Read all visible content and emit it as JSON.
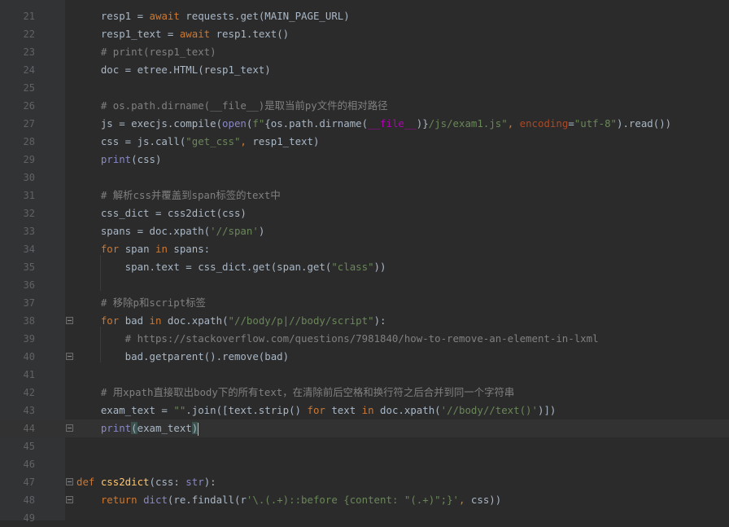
{
  "editor": {
    "lines": [
      {
        "num": "21",
        "segments": [
          [
            "n",
            "    resp1 = "
          ],
          [
            "kw",
            "await"
          ],
          [
            "n",
            " requests.get(MAIN_PAGE_URL)"
          ]
        ]
      },
      {
        "num": "22",
        "segments": [
          [
            "n",
            "    resp1_text = "
          ],
          [
            "kw",
            "await"
          ],
          [
            "n",
            " resp1.text()"
          ]
        ]
      },
      {
        "num": "23",
        "segments": [
          [
            "cm",
            "    # print(resp1_text)"
          ]
        ]
      },
      {
        "num": "24",
        "segments": [
          [
            "n",
            "    doc = etree.HTML(resp1_text)"
          ]
        ]
      },
      {
        "num": "25",
        "segments": []
      },
      {
        "num": "26",
        "segments": [
          [
            "cm",
            "    # os.path.dirname(__file__)是取当前py文件的相对路径"
          ]
        ]
      },
      {
        "num": "27",
        "segments": [
          [
            "n",
            "    js = execjs.compile("
          ],
          [
            "bi",
            "open"
          ],
          [
            "n",
            "("
          ],
          [
            "str",
            "f\""
          ],
          [
            "n",
            "{os.path.dirname("
          ],
          [
            "mg",
            "__file__"
          ],
          [
            "n",
            ")}"
          ],
          [
            "str",
            "/js/exam1.js\""
          ],
          [
            "kw",
            ", "
          ],
          [
            "kwarg",
            "encoding"
          ],
          [
            "n",
            "="
          ],
          [
            "str",
            "\"utf-8\""
          ],
          [
            "n",
            ").read())"
          ]
        ]
      },
      {
        "num": "28",
        "segments": [
          [
            "n",
            "    css = js.call("
          ],
          [
            "str",
            "\"get_css\""
          ],
          [
            "kw",
            ","
          ],
          [
            "n",
            " resp1_text)"
          ]
        ]
      },
      {
        "num": "29",
        "segments": [
          [
            "n",
            "    "
          ],
          [
            "bi",
            "print"
          ],
          [
            "n",
            "(css)"
          ]
        ]
      },
      {
        "num": "30",
        "segments": []
      },
      {
        "num": "31",
        "segments": [
          [
            "cm",
            "    # 解析css并覆盖到span标签的text中"
          ]
        ]
      },
      {
        "num": "32",
        "segments": [
          [
            "n",
            "    css_dict = css2dict(css)"
          ]
        ]
      },
      {
        "num": "33",
        "segments": [
          [
            "n",
            "    spans = doc.xpath("
          ],
          [
            "str",
            "'//span'"
          ],
          [
            "n",
            ")"
          ]
        ]
      },
      {
        "num": "34",
        "segments": [
          [
            "n",
            "    "
          ],
          [
            "kw",
            "for"
          ],
          [
            "n",
            " span "
          ],
          [
            "kw",
            "in"
          ],
          [
            "n",
            " spans:"
          ]
        ]
      },
      {
        "num": "35",
        "segments": [
          [
            "n",
            "        span.text = css_dict.get(span.get("
          ],
          [
            "str",
            "\"class\""
          ],
          [
            "n",
            "))"
          ]
        ]
      },
      {
        "num": "36",
        "segments": []
      },
      {
        "num": "37",
        "segments": [
          [
            "cm",
            "    # 移除p和script标签"
          ]
        ]
      },
      {
        "num": "38",
        "segments": [
          [
            "n",
            "    "
          ],
          [
            "kw",
            "for"
          ],
          [
            "n",
            " bad "
          ],
          [
            "kw",
            "in"
          ],
          [
            "n",
            " doc.xpath("
          ],
          [
            "str",
            "\"//body/p|//body/script\""
          ],
          [
            "n",
            "):"
          ]
        ]
      },
      {
        "num": "39",
        "segments": [
          [
            "cm",
            "        # https://stackoverflow.com/questions/7981840/how-to-remove-an-element-in-lxml"
          ]
        ]
      },
      {
        "num": "40",
        "segments": [
          [
            "n",
            "        bad.getparent().remove(bad)"
          ]
        ]
      },
      {
        "num": "41",
        "segments": []
      },
      {
        "num": "42",
        "segments": [
          [
            "cm",
            "    # 用xpath直接取出body下的所有text，在清除前后空格和换行符之后合并到同一个字符串"
          ]
        ]
      },
      {
        "num": "43",
        "segments": [
          [
            "n",
            "    exam_text = "
          ],
          [
            "str",
            "\"\""
          ],
          [
            "n",
            ".join([text.strip() "
          ],
          [
            "kw",
            "for"
          ],
          [
            "n",
            " text "
          ],
          [
            "kw",
            "in"
          ],
          [
            "n",
            " doc.xpath("
          ],
          [
            "str",
            "'//body//text()'"
          ],
          [
            "n",
            ")])"
          ]
        ]
      },
      {
        "num": "44",
        "segments": [
          [
            "n",
            "    "
          ],
          [
            "bi",
            "print"
          ],
          [
            "br",
            "("
          ],
          [
            "n",
            "exam_text"
          ],
          [
            "br",
            ")"
          ],
          [
            "caret",
            ""
          ]
        ]
      },
      {
        "num": "45",
        "segments": []
      },
      {
        "num": "46",
        "segments": []
      },
      {
        "num": "47",
        "segments": [
          [
            "kw",
            "def "
          ],
          [
            "fn",
            "css2dict"
          ],
          [
            "n",
            "(css: "
          ],
          [
            "bi",
            "str"
          ],
          [
            "n",
            "):"
          ]
        ]
      },
      {
        "num": "48",
        "segments": [
          [
            "n",
            "    "
          ],
          [
            "kw",
            "return"
          ],
          [
            "n",
            " "
          ],
          [
            "bi",
            "dict"
          ],
          [
            "n",
            "(re.findall(r"
          ],
          [
            "str",
            "'\\.(.+)::before {content: \"(.+)\";}'"
          ],
          [
            "kw",
            ","
          ],
          [
            "n",
            " css))"
          ]
        ]
      },
      {
        "num": "49",
        "segments": []
      }
    ],
    "current_line": "44",
    "fold_markers": [
      "38",
      "40",
      "44",
      "47",
      "48"
    ],
    "colors": {
      "background": "#2b2b2b",
      "gutter": "#313335",
      "line_numbers": "#606366",
      "keyword": "#cc7832",
      "string": "#6a8759",
      "comment": "#808080",
      "builtin": "#8888c6",
      "function_def": "#ffc66d",
      "magic": "#b200b2",
      "keyword_arg": "#aa4926",
      "text": "#a9b7c6"
    }
  }
}
